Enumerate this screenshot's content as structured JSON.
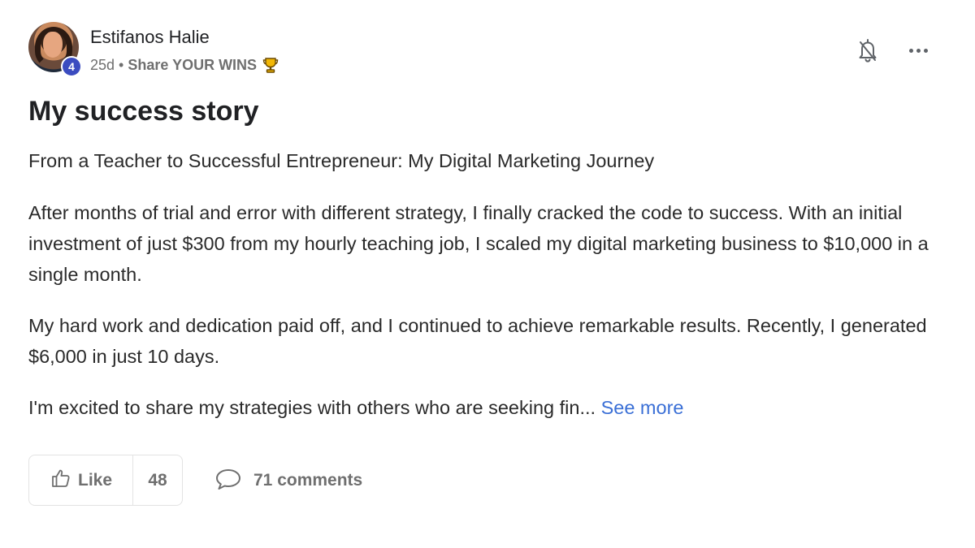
{
  "post": {
    "author": {
      "name": "Estifanos Halie",
      "level": "4",
      "avatar_icon": "user-avatar-photo"
    },
    "meta": {
      "age": "25d",
      "separator": "•",
      "category": "Share YOUR WINS",
      "category_icon": "trophy-icon"
    },
    "actions": {
      "notification_icon": "bell-off-icon",
      "more_icon": "more-horizontal-icon"
    },
    "title": "My success story",
    "body": {
      "paragraph_1": "From a Teacher to Successful Entrepreneur: My Digital Marketing Journey",
      "paragraph_2": "After months of trial and error with different strategy, I finally cracked the code to success. With an initial investment of just $300 from my hourly teaching job, I scaled my digital marketing business to $10,000 in a single month.",
      "paragraph_3": "My hard work and dedication paid off, and I continued to achieve remarkable results. Recently, I generated $6,000 in just 10 days.",
      "paragraph_4": "I'm excited to share my strategies with others who are seeking fin...",
      "see_more": "See more"
    },
    "footer": {
      "like_label": "Like",
      "like_icon": "thumbs-up-icon",
      "like_count": "48",
      "comments_label": "71 comments",
      "comments_icon": "comment-bubble-icon"
    }
  },
  "colors": {
    "link": "#3a6fd6",
    "level_badge": "#3b4cc0",
    "muted_text": "#6f6f6f",
    "trophy": "#e0a800"
  }
}
